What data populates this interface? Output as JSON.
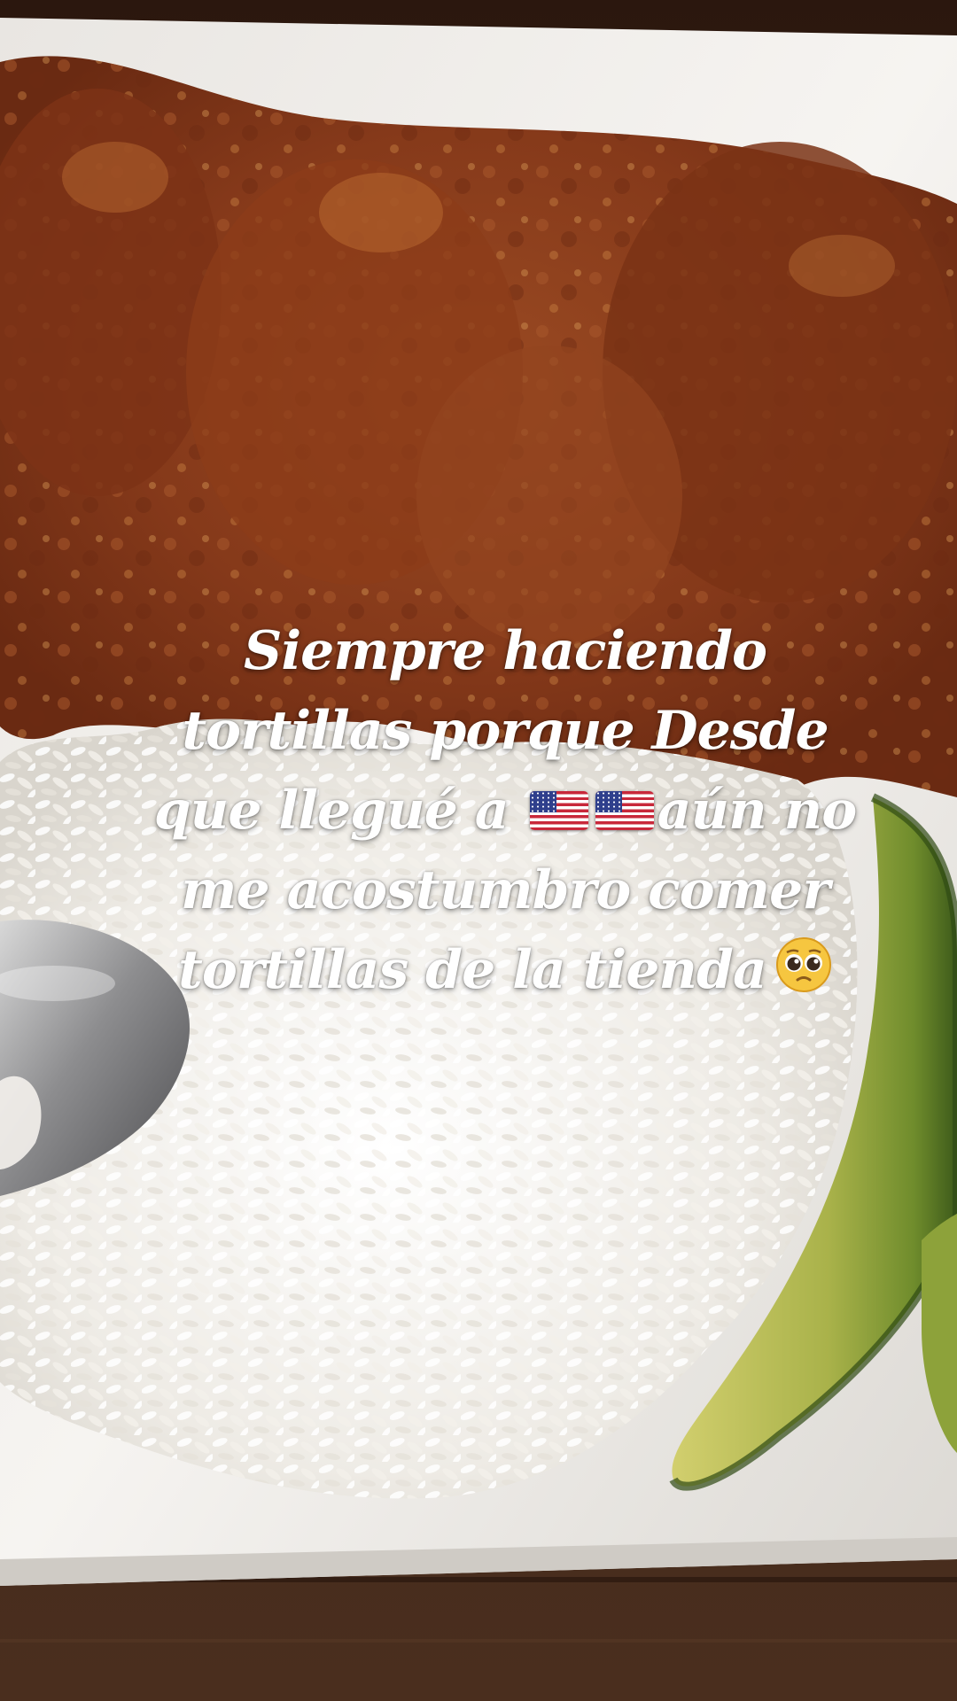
{
  "caption": {
    "line1": "Siempre haciendo",
    "line2": "tortillas porque Desde",
    "line3_a": "que llegué a ",
    "flags": [
      "us-flag-icon",
      "us-flag-icon"
    ],
    "line3_b": "aún no",
    "line4": "me acostumbro comer",
    "line5": "tortillas de la tienda",
    "emoji": "pleading-face-icon"
  },
  "colors": {
    "table": "#3a2418",
    "plate": "#f4f2ef",
    "sauce": "#8e3d1c",
    "rice": "#f1eee8",
    "avocado": "#a7b04a",
    "caption_text": "#ffffff"
  }
}
